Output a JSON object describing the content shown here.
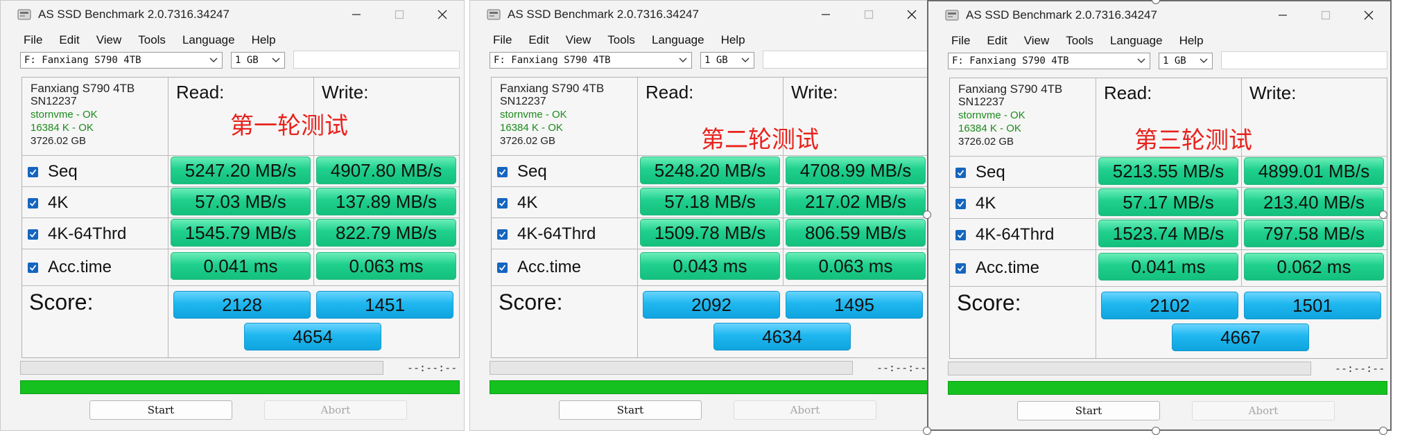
{
  "windows": [
    {
      "title": "AS SSD Benchmark 2.0.7316.34247",
      "menu": [
        "File",
        "Edit",
        "View",
        "Tools",
        "Language",
        "Help"
      ],
      "drive_select": "F: Fanxiang S790 4TB",
      "size_select": "1 GB",
      "info": [
        "Fanxiang S790 4TB",
        "SN12237",
        "stornvme - OK",
        "16384 K - OK",
        "3726.02 GB"
      ],
      "read_label": "Read:",
      "write_label": "Write:",
      "annotation": "第一轮测试",
      "rows": [
        {
          "label": "Seq",
          "read": "5247.20 MB/s",
          "write": "4907.80 MB/s"
        },
        {
          "label": "4K",
          "read": "57.03 MB/s",
          "write": "137.89 MB/s"
        },
        {
          "label": "4K-64Thrd",
          "read": "1545.79 MB/s",
          "write": "822.79 MB/s"
        },
        {
          "label": "Acc.time",
          "read": "0.041 ms",
          "write": "0.063 ms"
        }
      ],
      "score_label": "Score:",
      "score_read": "2128",
      "score_write": "1451",
      "score_total": "4654",
      "timer": "--:--:--",
      "start_label": "Start",
      "abort_label": "Abort"
    },
    {
      "title": "AS SSD Benchmark 2.0.7316.34247",
      "menu": [
        "File",
        "Edit",
        "View",
        "Tools",
        "Language",
        "Help"
      ],
      "drive_select": "F: Fanxiang S790 4TB",
      "size_select": "1 GB",
      "info": [
        "Fanxiang S790 4TB",
        "SN12237",
        "stornvme - OK",
        "16384 K - OK",
        "3726.02 GB"
      ],
      "read_label": "Read:",
      "write_label": "Write:",
      "annotation": "第二轮测试",
      "rows": [
        {
          "label": "Seq",
          "read": "5248.20 MB/s",
          "write": "4708.99 MB/s"
        },
        {
          "label": "4K",
          "read": "57.18 MB/s",
          "write": "217.02 MB/s"
        },
        {
          "label": "4K-64Thrd",
          "read": "1509.78 MB/s",
          "write": "806.59 MB/s"
        },
        {
          "label": "Acc.time",
          "read": "0.043 ms",
          "write": "0.063 ms"
        }
      ],
      "score_label": "Score:",
      "score_read": "2092",
      "score_write": "1495",
      "score_total": "4634",
      "timer": "--:--:--",
      "start_label": "Start",
      "abort_label": "Abort"
    },
    {
      "title": "AS SSD Benchmark 2.0.7316.34247",
      "menu": [
        "File",
        "Edit",
        "View",
        "Tools",
        "Language",
        "Help"
      ],
      "drive_select": "F: Fanxiang S790 4TB",
      "size_select": "1 GB",
      "info": [
        "Fanxiang S790 4TB",
        "SN12237",
        "stornvme - OK",
        "16384 K - OK",
        "3726.02 GB"
      ],
      "read_label": "Read:",
      "write_label": "Write:",
      "annotation": "第三轮测试",
      "rows": [
        {
          "label": "Seq",
          "read": "5213.55 MB/s",
          "write": "4899.01 MB/s"
        },
        {
          "label": "4K",
          "read": "57.17 MB/s",
          "write": "213.40 MB/s"
        },
        {
          "label": "4K-64Thrd",
          "read": "1523.74 MB/s",
          "write": "797.58 MB/s"
        },
        {
          "label": "Acc.time",
          "read": "0.041 ms",
          "write": "0.062 ms"
        }
      ],
      "score_label": "Score:",
      "score_read": "2102",
      "score_write": "1501",
      "score_total": "4667",
      "timer": "--:--:--",
      "start_label": "Start",
      "abort_label": "Abort"
    }
  ],
  "progress_fraction": 1.0,
  "colors": {
    "value_green": "#1fd08c",
    "score_blue": "#1eb7ef",
    "progress_green": "#14c11f",
    "annotation_red": "#e8231d",
    "ok_green": "#1c8a1c"
  },
  "icons": [
    "app-icon",
    "minimize-icon",
    "maximize-icon",
    "close-icon",
    "chevron-down-icon",
    "checkbox-checked-icon"
  ]
}
